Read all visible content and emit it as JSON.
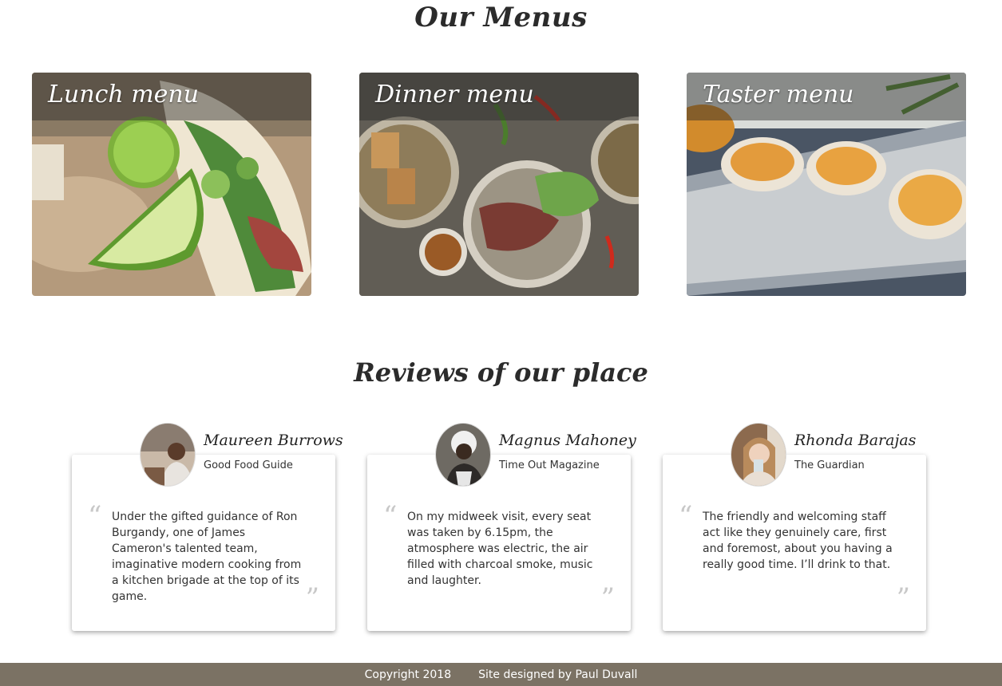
{
  "menus": {
    "title": "Our Menus",
    "cards": [
      {
        "label": "Lunch menu",
        "image": "tacos-with-lime-photo"
      },
      {
        "label": "Dinner menu",
        "image": "steak-salad-bowls-photo"
      },
      {
        "label": "Taster menu",
        "image": "stuffed-shells-platter-photo"
      }
    ]
  },
  "reviews": {
    "title": "Reviews of our place",
    "items": [
      {
        "name": "Maureen Burrows",
        "source": "Good Food Guide",
        "text": "Under the gifted guidance of Ron Burgandy, one of James Cameron's talented team, imaginative modern cooking from a kitchen brigade at the top of its game."
      },
      {
        "name": "Magnus Mahoney",
        "source": "Time Out Magazine",
        "text": "On my midweek visit, every seat was taken by 6.15pm, the atmosphere was electric, the air filled with charcoal smoke, music and laughter."
      },
      {
        "name": "Rhonda Barajas",
        "source": "The Guardian",
        "text": "The friendly and welcoming staff act like they genuinely care, first and foremost, about you having a really good time. I’ll drink to that."
      }
    ],
    "open_quote": "“",
    "close_quote": "”"
  },
  "footer": {
    "copyright": "Copyright 2018",
    "credit": "Site designed by Paul Duvall"
  },
  "colors": {
    "footer_bg": "#7b7264",
    "quote_marks": "#c8c8c8"
  }
}
